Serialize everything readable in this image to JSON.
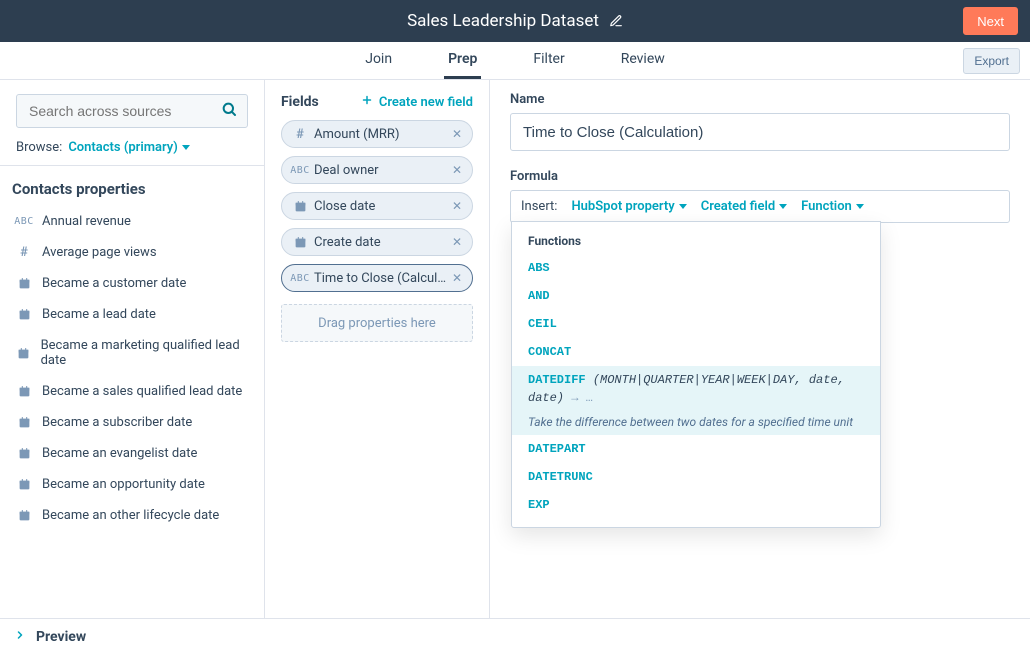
{
  "header": {
    "title": "Sales Leadership Dataset",
    "next_btn": "Next"
  },
  "tabs": {
    "join": "Join",
    "prep": "Prep",
    "filter": "Filter",
    "review": "Review",
    "active": "prep",
    "export_btn": "Export"
  },
  "left": {
    "search_placeholder": "Search across sources",
    "browse_label": "Browse:",
    "browse_value": "Contacts (primary)",
    "section_heading": "Contacts properties",
    "properties": [
      {
        "type": "abc",
        "label": "Annual revenue"
      },
      {
        "type": "hash",
        "label": "Average page views"
      },
      {
        "type": "date",
        "label": "Became a customer date"
      },
      {
        "type": "date",
        "label": "Became a lead date"
      },
      {
        "type": "date",
        "label": "Became a marketing qualified lead date"
      },
      {
        "type": "date",
        "label": "Became a sales qualified lead date"
      },
      {
        "type": "date",
        "label": "Became a subscriber date"
      },
      {
        "type": "date",
        "label": "Became an evangelist date"
      },
      {
        "type": "date",
        "label": "Became an opportunity date"
      },
      {
        "type": "date",
        "label": "Became an other lifecycle date"
      }
    ]
  },
  "mid": {
    "fields_heading": "Fields",
    "create_link": "Create new field",
    "pills": [
      {
        "type": "hash",
        "label": "Amount (MRR)"
      },
      {
        "type": "abc",
        "label": "Deal owner"
      },
      {
        "type": "date",
        "label": "Close date"
      },
      {
        "type": "date",
        "label": "Create date"
      },
      {
        "type": "abc",
        "label": "Time to Close (Calculation)",
        "emph": true
      }
    ],
    "dropzone": "Drag properties here"
  },
  "right": {
    "name_label": "Name",
    "name_value": "Time to Close (Calculation)",
    "formula_label": "Formula",
    "insert_label": "Insert:",
    "insert_hs_property": "HubSpot property",
    "insert_created_field": "Created field",
    "insert_function": "Function",
    "popup": {
      "heading": "Functions",
      "items": [
        {
          "name": "ABS"
        },
        {
          "name": "AND"
        },
        {
          "name": "CEIL"
        },
        {
          "name": "CONCAT"
        },
        {
          "name": "DATEDIFF",
          "args_prefix": "(",
          "args": "MONTH|QUARTER|YEAR|WEEK|DAY, date, date",
          "args_suffix": ")",
          "arrow": " → …",
          "desc": "Take the difference between two dates for a specified time unit",
          "highlight": true
        },
        {
          "name": "DATEPART"
        },
        {
          "name": "DATETRUNC"
        },
        {
          "name": "EXP"
        }
      ]
    }
  },
  "preview": {
    "label": "Preview"
  },
  "icons": {
    "abc": "ABC",
    "hash": "#"
  }
}
